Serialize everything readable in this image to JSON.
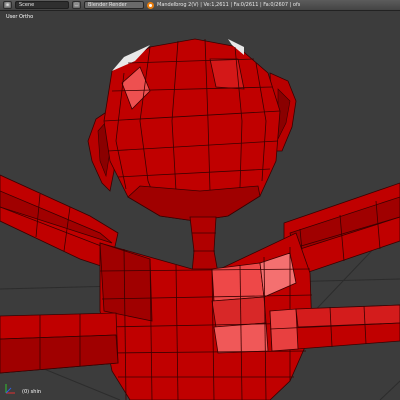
{
  "header": {
    "scene_field": "Scene",
    "render_engine": "Blender Render",
    "info_text": "Mandelbrog 2(V) | Ve:1,2611 | Fa:0/2611 | Fa:0/2607 | ofs"
  },
  "viewport": {
    "view_name": "User Ortho",
    "object_label": "(0) shin"
  },
  "colors": {
    "mesh": "#c00000",
    "mesh_dark": "#7a0000",
    "highlight": "#f06060",
    "background": "#3c3c3c",
    "header": "#4a4a4a"
  }
}
